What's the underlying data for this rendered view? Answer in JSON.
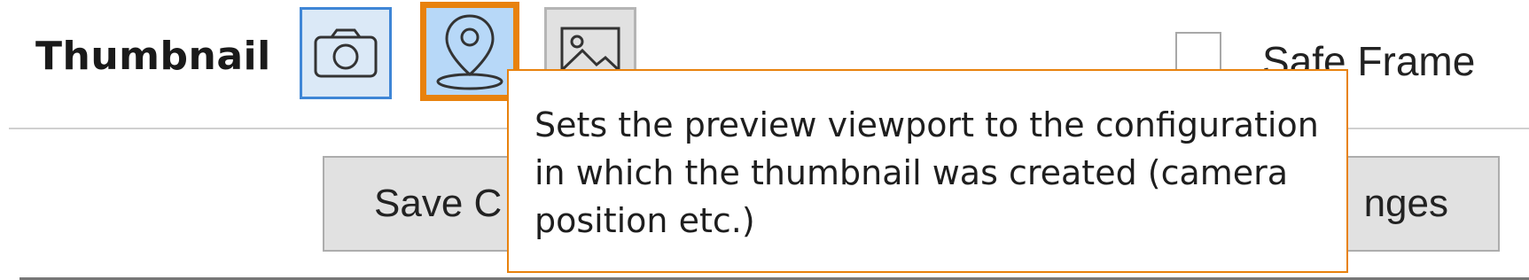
{
  "thumbnail": {
    "title": "Thumbnail",
    "buttons": [
      {
        "icon": "camera-icon",
        "state": "selected"
      },
      {
        "icon": "location-pin-icon",
        "state": "hovered"
      },
      {
        "icon": "image-icon",
        "state": "normal"
      }
    ]
  },
  "safe_frame": {
    "label": "Safe Frame",
    "checked": false
  },
  "actions": {
    "save_label": "Save C",
    "discard_label": "nges"
  },
  "tooltip": {
    "lines": [
      "Sets the preview viewport to the configuration",
      "in which the thumbnail was created (camera",
      "position etc.)"
    ]
  },
  "colors": {
    "accent_orange": "#e8820e",
    "selected_blue": "#3f86d6",
    "hover_fill": "#b7d8f8",
    "button_gray": "#e1e1e1"
  }
}
